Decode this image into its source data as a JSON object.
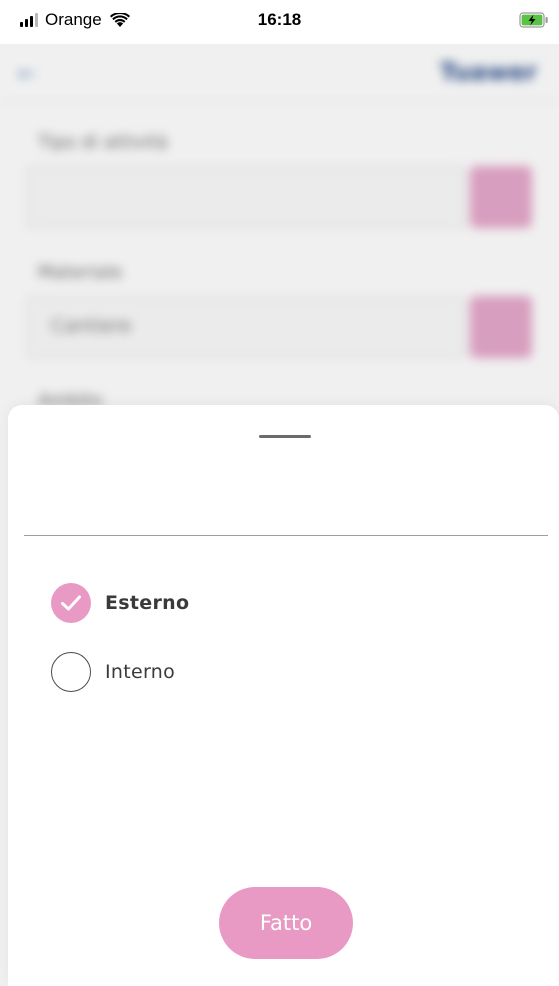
{
  "status_bar": {
    "carrier": "Orange",
    "time": "16:18"
  },
  "background": {
    "logo": "Tuawer",
    "fields": [
      {
        "label": "Tipo di attività",
        "value": ""
      },
      {
        "label": "Materiale",
        "value": "Cantiere"
      },
      {
        "label": "Ambito"
      }
    ]
  },
  "sheet": {
    "options": [
      {
        "label": "Esterno",
        "selected": true
      },
      {
        "label": "Interno",
        "selected": false
      }
    ],
    "done_label": "Fatto"
  },
  "colors": {
    "accent": "#e89ac4",
    "text": "#3a3a3a"
  }
}
